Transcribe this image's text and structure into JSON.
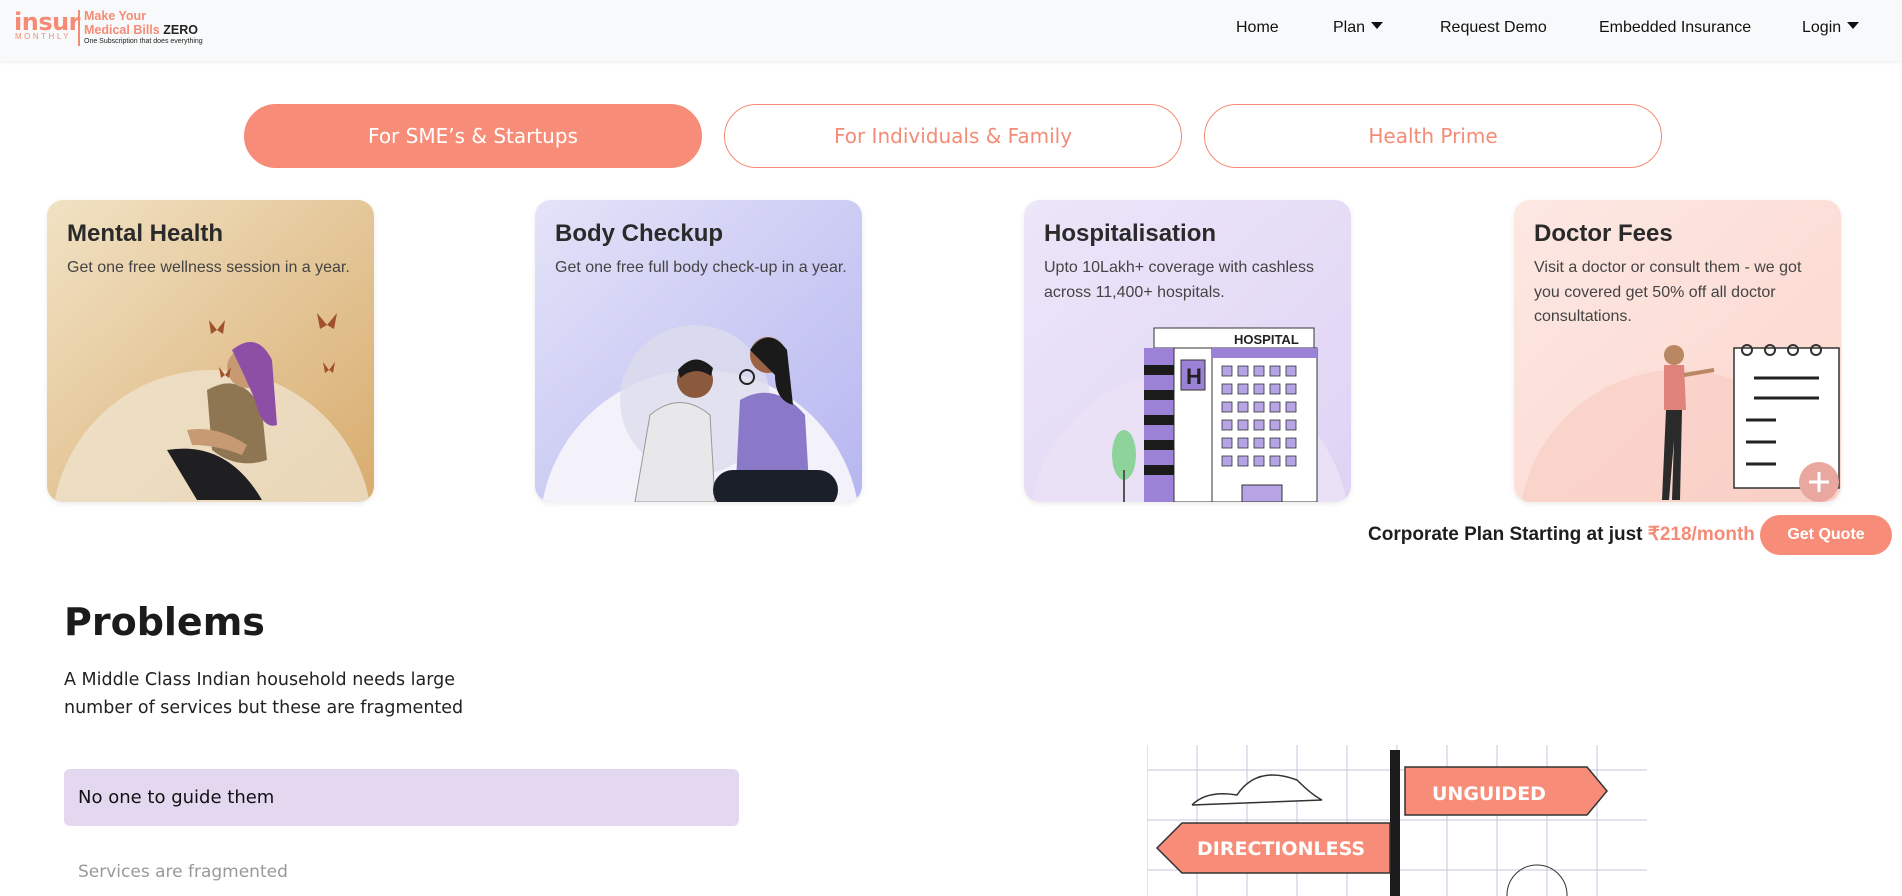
{
  "brand": {
    "logo_word": "insur",
    "logo_sub": "MONTHLY",
    "tagline_line1": "Make Your",
    "tagline_line2": "Medical Bills",
    "tagline_zero": "ZERO",
    "tagline_small": "One Subscription that does everything",
    "accent": "#f58b76"
  },
  "nav": {
    "home": "Home",
    "plan": "Plan",
    "request_demo": "Request Demo",
    "embedded": "Embedded Insurance",
    "login": "Login"
  },
  "tabs": [
    {
      "label": "For SME’s & Startups",
      "active": true
    },
    {
      "label": "For Individuals & Family",
      "active": false
    },
    {
      "label": "Health Prime",
      "active": false
    }
  ],
  "cards": [
    {
      "title": "Mental Health",
      "desc": "Get one free wellness session in a year.",
      "color": "#e9cfa5"
    },
    {
      "title": "Body Checkup",
      "desc": "Get one free full body check-up in a year.",
      "color": "#d2d2f7"
    },
    {
      "title": "Hospitalisation",
      "desc": "Upto 10Lakh+ coverage with cashless across 11,400+ hospitals.",
      "color": "#e6dbf6",
      "sign": "HOSPITAL",
      "letter": "H"
    },
    {
      "title": "Doctor Fees",
      "desc": "Visit a doctor or consult them - we got you covered get 50% off all doctor consultations.",
      "color": "#fce0da"
    }
  ],
  "quote": {
    "text": "Corporate Plan Starting at just",
    "price": "₹218/month",
    "button": "Get Quote"
  },
  "problems": {
    "title": "Problems",
    "desc": "A Middle Class Indian household needs large number of services but these are fragmented",
    "items": [
      "No one to guide them",
      "Services are fragmented"
    ],
    "sign_right": "UNGUIDED",
    "sign_left": "DIRECTIONLESS"
  }
}
